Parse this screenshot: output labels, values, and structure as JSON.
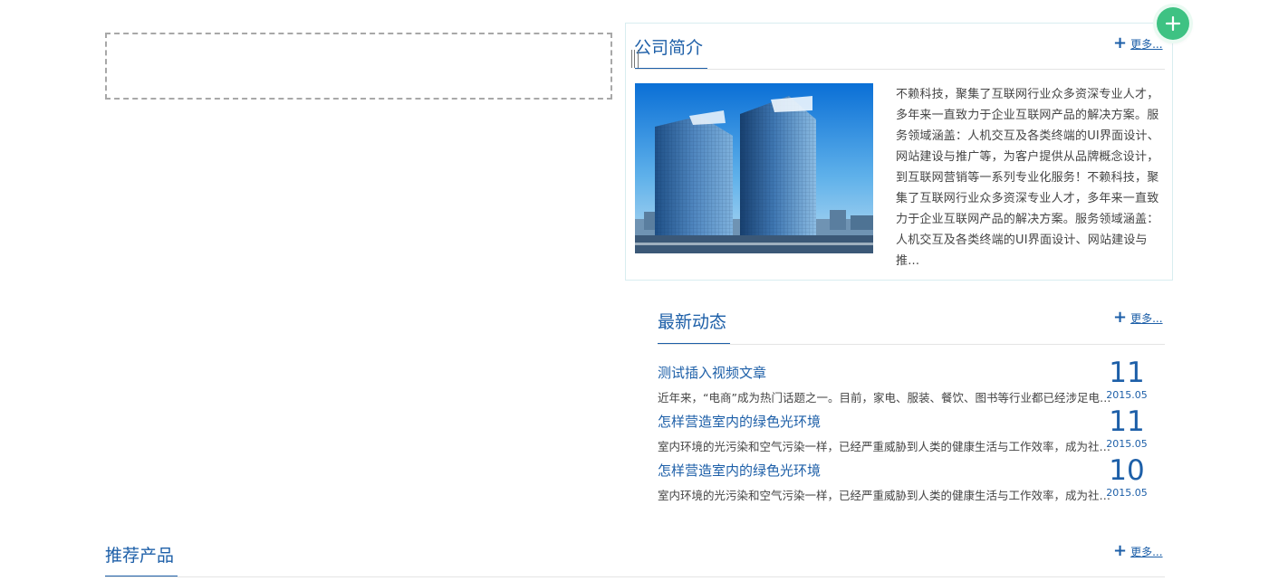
{
  "about": {
    "title": "公司简介",
    "more_label": "更多...",
    "text": "不赖科技，聚集了互联网行业众多资深专业人才，多年来一直致力于企业互联网产品的解决方案。服务领域涵盖：人机交互及各类终端的UI界面设计、网站建设与推广等，为客户提供从品牌概念设计，到互联网营销等一系列专业化服务！不赖科技，聚集了互联网行业众多资深专业人才，多年来一直致力于企业互联网产品的解决方案。服务领域涵盖：人机交互及各类终端的UI界面设计、网站建设与推...",
    "image_icon": "office-towers-image"
  },
  "news": {
    "title": "最新动态",
    "more_label": "更多...",
    "items": [
      {
        "title": "测试插入视频文章",
        "summary": "近年来，“电商”成为热门话题之一。目前，家电、服装、餐饮、图书等行业都已经涉足电子商务",
        "day": "11",
        "month": "2015.05"
      },
      {
        "title": "怎样营造室内的绿色光环境",
        "summary": "室内环境的光污染和空气污染一样，已经严重威胁到人类的健康生活与工作效率，成为社会的新问题",
        "day": "11",
        "month": "2015.05"
      },
      {
        "title": "怎样营造室内的绿色光环境",
        "summary": "室内环境的光污染和空气污染一样，已经严重威胁到人类的健康生活与工作效率，成为社会的新问题",
        "day": "10",
        "month": "2015.05"
      }
    ]
  },
  "products": {
    "title": "推荐产品",
    "more_label": "更多..."
  },
  "icons": {
    "plus": "plus-icon",
    "add": "add-circle-icon"
  },
  "colors": {
    "accent": "#1d5fa8",
    "add_button": "#3ec283",
    "panel_border": "#d8edf0"
  }
}
